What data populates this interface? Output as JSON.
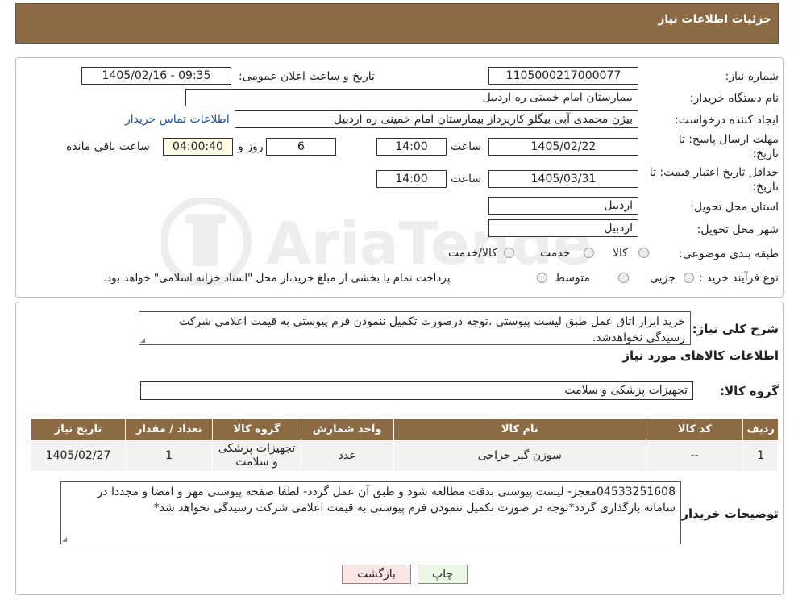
{
  "header": {
    "title": "جزئیات اطلاعات نیاز"
  },
  "form": {
    "need_number_label": "شماره نیاز:",
    "need_number": "1105000217000077",
    "announce_label": "تاریخ و ساعت اعلان عمومی:",
    "announce_value": "1405/02/16 - 09:35",
    "buyer_org_label": "نام دستگاه خریدار:",
    "buyer_org": "بیمارستان امام خمینی  ره  اردبیل",
    "creator_label": "ایجاد کننده درخواست:",
    "creator": "بیژن محمدی آبی بیگلو کارپرداز بیمارستان امام خمینی  ره  اردبیل",
    "contact_link": "اطلاعات تماس خریدار",
    "deadline_label_1": "مهلت ارسال پاسخ: تا",
    "deadline_label_2": "تاریخ:",
    "deadline_date": "1405/02/22",
    "time_label": "ساعت",
    "deadline_time": "14:00",
    "days_value": "6",
    "days_label": "روز و",
    "remaining_time": "04:00:40",
    "remaining_label": "ساعت باقی مانده",
    "validity_label_1": "حداقل تاریخ اعتبار قیمت: تا",
    "validity_label_2": "تاریخ:",
    "validity_date": "1405/03/31",
    "validity_time": "14:00",
    "province_label": "استان محل تحویل:",
    "province": "اردبیل",
    "city_label": "شهر محل تحویل:",
    "city": "اردبیل",
    "category_label": "طبقه بندی موضوعی:",
    "category_options": [
      "کالا",
      "خدمت",
      "کالا/خدمت"
    ],
    "process_label": "نوع فرآیند خرید :",
    "process_options": [
      "جزیی",
      "متوسط"
    ],
    "process_note": "پرداخت تمام یا بخشی از مبلغ خرید،از محل \"اسناد خزانه اسلامی\" خواهد بود."
  },
  "summary": {
    "label": "شرح کلی نیاز:",
    "text": "خرید ابزار اتاق عمل طبق لیست پیوستی ،توجه درصورت تکمیل ننمودن فرم پیوستی به قیمت اعلامی شرکت رسیدگی نخواهدشد.",
    "goods_info_title": "اطلاعات کالاهای مورد نیاز",
    "goods_group_label": "گروه کالا:",
    "goods_group": "تجهیزات پزشکی و سلامت"
  },
  "table": {
    "headers": [
      "ردیف",
      "کد کالا",
      "نام کالا",
      "واحد شمارش",
      "گروه کالا",
      "تعداد / مقدار",
      "تاریخ نیاز"
    ],
    "rows": [
      [
        "1",
        "--",
        "سوزن گیر جراحی",
        "عدد",
        "تجهیزات پزشکی و سلامت",
        "1",
        "1405/02/27"
      ]
    ]
  },
  "buyer_notes": {
    "label": "توضیحات خریدار:",
    "text": "04533251608معجز- لیست پیوستی بدقت مطالعه شود و طبق آن عمل گردد- لطفا صفحه پیوستی مهر و امضا و مجددا در سامانه بارگذاری گردد*توجه در صورت تکمیل ننمودن فرم پیوستی به قیمت اعلامی شرکت رسیدگی نخواهد شد*"
  },
  "buttons": {
    "print": "چاپ",
    "back": "بازگشت"
  },
  "watermark": {
    "text": "AriaTender.neT"
  },
  "colors": {
    "header_bg": "#8b6a44",
    "link": "#1a53a8",
    "print_btn": "#e9f7e4",
    "back_btn": "#fbe6e6"
  }
}
